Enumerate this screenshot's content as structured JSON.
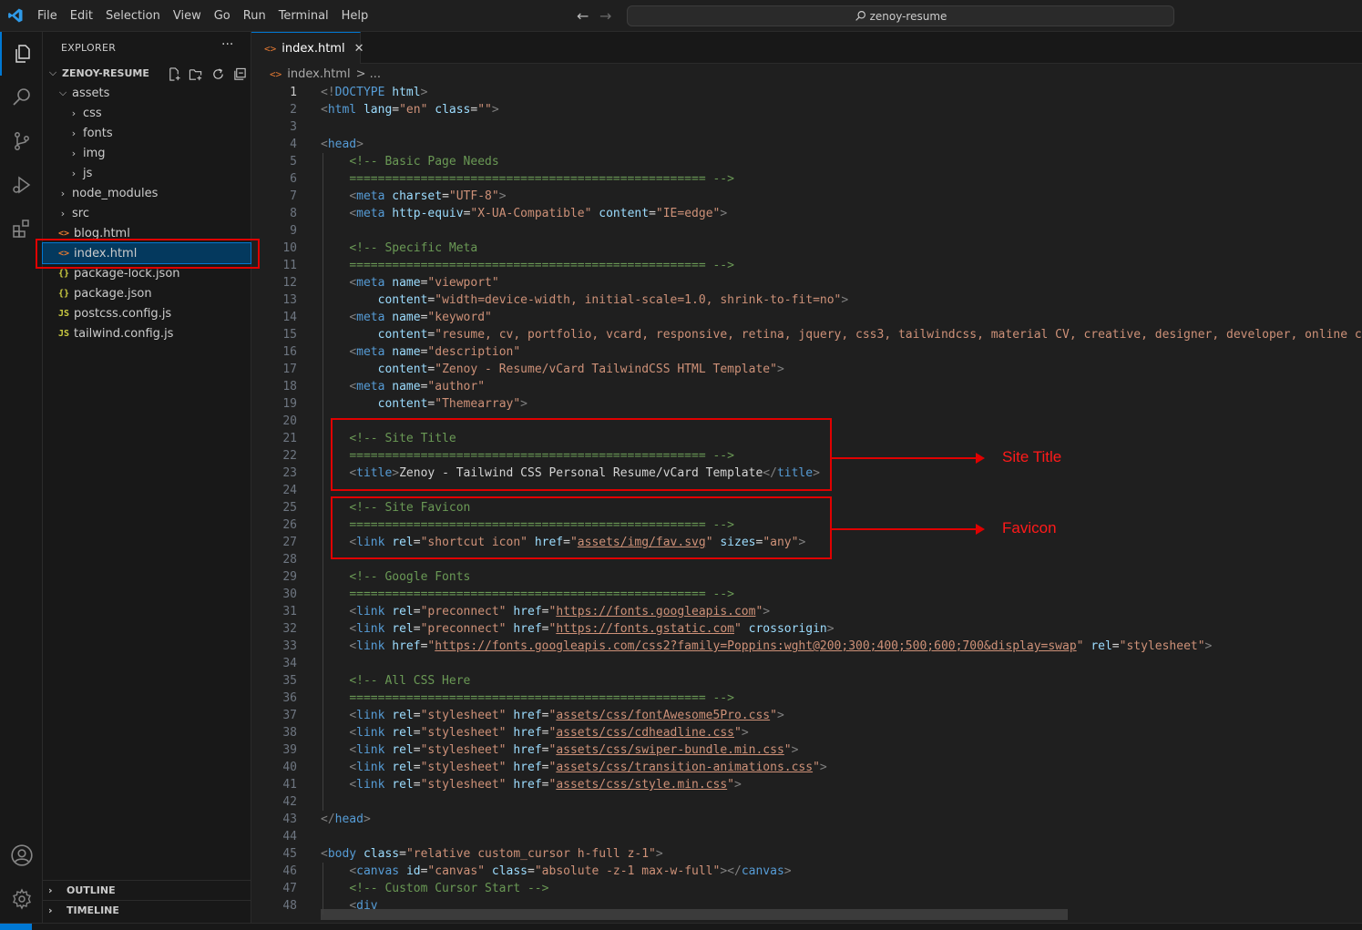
{
  "menu": [
    "File",
    "Edit",
    "Selection",
    "View",
    "Go",
    "Run",
    "Terminal",
    "Help"
  ],
  "search": {
    "text": "zenoy-resume"
  },
  "sidebar": {
    "title": "EXPLORER",
    "more": "···",
    "root": "ZENOY-RESUME",
    "tree": [
      {
        "label": "assets",
        "type": "folder-open",
        "depth": 1
      },
      {
        "label": "css",
        "type": "folder",
        "depth": 2
      },
      {
        "label": "fonts",
        "type": "folder",
        "depth": 2
      },
      {
        "label": "img",
        "type": "folder",
        "depth": 2
      },
      {
        "label": "js",
        "type": "folder",
        "depth": 2
      },
      {
        "label": "node_modules",
        "type": "folder",
        "depth": 1
      },
      {
        "label": "src",
        "type": "folder",
        "depth": 1
      },
      {
        "label": "blog.html",
        "type": "html",
        "depth": 1
      },
      {
        "label": "index.html",
        "type": "html",
        "depth": 1,
        "selected": true
      },
      {
        "label": "package-lock.json",
        "type": "json",
        "depth": 1
      },
      {
        "label": "package.json",
        "type": "json",
        "depth": 1
      },
      {
        "label": "postcss.config.js",
        "type": "js",
        "depth": 1
      },
      {
        "label": "tailwind.config.js",
        "type": "js",
        "depth": 1
      }
    ],
    "outline": "OUTLINE",
    "timeline": "TIMELINE"
  },
  "tab": {
    "label": "index.html",
    "close": "✕"
  },
  "breadcrumb": {
    "file": "index.html",
    "rest": "> ..."
  },
  "annotations": {
    "site_title": "Site Title",
    "favicon": "Favicon"
  },
  "code": [
    [
      [
        "t",
        "<!"
      ],
      [
        "n",
        "DOCTYPE"
      ],
      [
        "x",
        " "
      ],
      [
        "a",
        "html"
      ],
      [
        "t",
        ">"
      ]
    ],
    [
      [
        "t",
        "<"
      ],
      [
        "n",
        "html"
      ],
      [
        "x",
        " "
      ],
      [
        "a",
        "lang"
      ],
      [
        "x",
        "="
      ],
      [
        "s",
        "\"en\""
      ],
      [
        "x",
        " "
      ],
      [
        "a",
        "class"
      ],
      [
        "x",
        "="
      ],
      [
        "s",
        "\"\""
      ],
      [
        "t",
        ">"
      ]
    ],
    [],
    [
      [
        "t",
        "<"
      ],
      [
        "n",
        "head"
      ],
      [
        "t",
        ">"
      ]
    ],
    [
      [
        "x",
        "    "
      ],
      [
        "c",
        "<!-- Basic Page Needs"
      ]
    ],
    [
      [
        "x",
        "    "
      ],
      [
        "c",
        "================================================== -->"
      ]
    ],
    [
      [
        "x",
        "    "
      ],
      [
        "t",
        "<"
      ],
      [
        "n",
        "meta"
      ],
      [
        "x",
        " "
      ],
      [
        "a",
        "charset"
      ],
      [
        "x",
        "="
      ],
      [
        "s",
        "\"UTF-8\""
      ],
      [
        "t",
        ">"
      ]
    ],
    [
      [
        "x",
        "    "
      ],
      [
        "t",
        "<"
      ],
      [
        "n",
        "meta"
      ],
      [
        "x",
        " "
      ],
      [
        "a",
        "http-equiv"
      ],
      [
        "x",
        "="
      ],
      [
        "s",
        "\"X-UA-Compatible\""
      ],
      [
        "x",
        " "
      ],
      [
        "a",
        "content"
      ],
      [
        "x",
        "="
      ],
      [
        "s",
        "\"IE=edge\""
      ],
      [
        "t",
        ">"
      ]
    ],
    [],
    [
      [
        "x",
        "    "
      ],
      [
        "c",
        "<!-- Specific Meta"
      ]
    ],
    [
      [
        "x",
        "    "
      ],
      [
        "c",
        "================================================== -->"
      ]
    ],
    [
      [
        "x",
        "    "
      ],
      [
        "t",
        "<"
      ],
      [
        "n",
        "meta"
      ],
      [
        "x",
        " "
      ],
      [
        "a",
        "name"
      ],
      [
        "x",
        "="
      ],
      [
        "s",
        "\"viewport\""
      ]
    ],
    [
      [
        "x",
        "        "
      ],
      [
        "a",
        "content"
      ],
      [
        "x",
        "="
      ],
      [
        "s",
        "\"width=device-width, initial-scale=1.0, shrink-to-fit=no\""
      ],
      [
        "t",
        ">"
      ]
    ],
    [
      [
        "x",
        "    "
      ],
      [
        "t",
        "<"
      ],
      [
        "n",
        "meta"
      ],
      [
        "x",
        " "
      ],
      [
        "a",
        "name"
      ],
      [
        "x",
        "="
      ],
      [
        "s",
        "\"keyword\""
      ]
    ],
    [
      [
        "x",
        "        "
      ],
      [
        "a",
        "content"
      ],
      [
        "x",
        "="
      ],
      [
        "s",
        "\"resume, cv, portfolio, vcard, responsive, retina, jquery, css3, tailwindcss, material CV, creative, designer, developer, online cv,"
      ]
    ],
    [
      [
        "x",
        "    "
      ],
      [
        "t",
        "<"
      ],
      [
        "n",
        "meta"
      ],
      [
        "x",
        " "
      ],
      [
        "a",
        "name"
      ],
      [
        "x",
        "="
      ],
      [
        "s",
        "\"description\""
      ]
    ],
    [
      [
        "x",
        "        "
      ],
      [
        "a",
        "content"
      ],
      [
        "x",
        "="
      ],
      [
        "s",
        "\"Zenoy - Resume/vCard TailwindCSS HTML Template\""
      ],
      [
        "t",
        ">"
      ]
    ],
    [
      [
        "x",
        "    "
      ],
      [
        "t",
        "<"
      ],
      [
        "n",
        "meta"
      ],
      [
        "x",
        " "
      ],
      [
        "a",
        "name"
      ],
      [
        "x",
        "="
      ],
      [
        "s",
        "\"author\""
      ]
    ],
    [
      [
        "x",
        "        "
      ],
      [
        "a",
        "content"
      ],
      [
        "x",
        "="
      ],
      [
        "s",
        "\"Themearray\""
      ],
      [
        "t",
        ">"
      ]
    ],
    [],
    [
      [
        "x",
        "    "
      ],
      [
        "c",
        "<!-- Site Title"
      ]
    ],
    [
      [
        "x",
        "    "
      ],
      [
        "c",
        "================================================== -->"
      ]
    ],
    [
      [
        "x",
        "    "
      ],
      [
        "t",
        "<"
      ],
      [
        "n",
        "title"
      ],
      [
        "t",
        ">"
      ],
      [
        "x",
        "Zenoy - Tailwind CSS Personal Resume/vCard Template"
      ],
      [
        "t",
        "</"
      ],
      [
        "n",
        "title"
      ],
      [
        "t",
        ">"
      ]
    ],
    [],
    [
      [
        "x",
        "    "
      ],
      [
        "c",
        "<!-- Site Favicon"
      ]
    ],
    [
      [
        "x",
        "    "
      ],
      [
        "c",
        "================================================== -->"
      ]
    ],
    [
      [
        "x",
        "    "
      ],
      [
        "t",
        "<"
      ],
      [
        "n",
        "link"
      ],
      [
        "x",
        " "
      ],
      [
        "a",
        "rel"
      ],
      [
        "x",
        "="
      ],
      [
        "s",
        "\"shortcut icon\""
      ],
      [
        "x",
        " "
      ],
      [
        "a",
        "href"
      ],
      [
        "x",
        "="
      ],
      [
        "s",
        "\""
      ],
      [
        "l",
        "assets/img/fav.svg"
      ],
      [
        "s",
        "\""
      ],
      [
        "x",
        " "
      ],
      [
        "a",
        "sizes"
      ],
      [
        "x",
        "="
      ],
      [
        "s",
        "\"any\""
      ],
      [
        "t",
        ">"
      ]
    ],
    [],
    [
      [
        "x",
        "    "
      ],
      [
        "c",
        "<!-- Google Fonts"
      ]
    ],
    [
      [
        "x",
        "    "
      ],
      [
        "c",
        "================================================== -->"
      ]
    ],
    [
      [
        "x",
        "    "
      ],
      [
        "t",
        "<"
      ],
      [
        "n",
        "link"
      ],
      [
        "x",
        " "
      ],
      [
        "a",
        "rel"
      ],
      [
        "x",
        "="
      ],
      [
        "s",
        "\"preconnect\""
      ],
      [
        "x",
        " "
      ],
      [
        "a",
        "href"
      ],
      [
        "x",
        "="
      ],
      [
        "s",
        "\""
      ],
      [
        "l",
        "https://fonts.googleapis.com"
      ],
      [
        "s",
        "\""
      ],
      [
        "t",
        ">"
      ]
    ],
    [
      [
        "x",
        "    "
      ],
      [
        "t",
        "<"
      ],
      [
        "n",
        "link"
      ],
      [
        "x",
        " "
      ],
      [
        "a",
        "rel"
      ],
      [
        "x",
        "="
      ],
      [
        "s",
        "\"preconnect\""
      ],
      [
        "x",
        " "
      ],
      [
        "a",
        "href"
      ],
      [
        "x",
        "="
      ],
      [
        "s",
        "\""
      ],
      [
        "l",
        "https://fonts.gstatic.com"
      ],
      [
        "s",
        "\""
      ],
      [
        "x",
        " "
      ],
      [
        "a",
        "crossorigin"
      ],
      [
        "t",
        ">"
      ]
    ],
    [
      [
        "x",
        "    "
      ],
      [
        "t",
        "<"
      ],
      [
        "n",
        "link"
      ],
      [
        "x",
        " "
      ],
      [
        "a",
        "href"
      ],
      [
        "x",
        "="
      ],
      [
        "s",
        "\""
      ],
      [
        "l",
        "https://fonts.googleapis.com/css2?family=Poppins:wght@200;300;400;500;600;700&display=swap"
      ],
      [
        "s",
        "\""
      ],
      [
        "x",
        " "
      ],
      [
        "a",
        "rel"
      ],
      [
        "x",
        "="
      ],
      [
        "s",
        "\"stylesheet\""
      ],
      [
        "t",
        ">"
      ]
    ],
    [],
    [
      [
        "x",
        "    "
      ],
      [
        "c",
        "<!-- All CSS Here"
      ]
    ],
    [
      [
        "x",
        "    "
      ],
      [
        "c",
        "================================================== -->"
      ]
    ],
    [
      [
        "x",
        "    "
      ],
      [
        "t",
        "<"
      ],
      [
        "n",
        "link"
      ],
      [
        "x",
        " "
      ],
      [
        "a",
        "rel"
      ],
      [
        "x",
        "="
      ],
      [
        "s",
        "\"stylesheet\""
      ],
      [
        "x",
        " "
      ],
      [
        "a",
        "href"
      ],
      [
        "x",
        "="
      ],
      [
        "s",
        "\""
      ],
      [
        "l",
        "assets/css/fontAwesome5Pro.css"
      ],
      [
        "s",
        "\""
      ],
      [
        "t",
        ">"
      ]
    ],
    [
      [
        "x",
        "    "
      ],
      [
        "t",
        "<"
      ],
      [
        "n",
        "link"
      ],
      [
        "x",
        " "
      ],
      [
        "a",
        "rel"
      ],
      [
        "x",
        "="
      ],
      [
        "s",
        "\"stylesheet\""
      ],
      [
        "x",
        " "
      ],
      [
        "a",
        "href"
      ],
      [
        "x",
        "="
      ],
      [
        "s",
        "\""
      ],
      [
        "l",
        "assets/css/cdheadline.css"
      ],
      [
        "s",
        "\""
      ],
      [
        "t",
        ">"
      ]
    ],
    [
      [
        "x",
        "    "
      ],
      [
        "t",
        "<"
      ],
      [
        "n",
        "link"
      ],
      [
        "x",
        " "
      ],
      [
        "a",
        "rel"
      ],
      [
        "x",
        "="
      ],
      [
        "s",
        "\"stylesheet\""
      ],
      [
        "x",
        " "
      ],
      [
        "a",
        "href"
      ],
      [
        "x",
        "="
      ],
      [
        "s",
        "\""
      ],
      [
        "l",
        "assets/css/swiper-bundle.min.css"
      ],
      [
        "s",
        "\""
      ],
      [
        "t",
        ">"
      ]
    ],
    [
      [
        "x",
        "    "
      ],
      [
        "t",
        "<"
      ],
      [
        "n",
        "link"
      ],
      [
        "x",
        " "
      ],
      [
        "a",
        "rel"
      ],
      [
        "x",
        "="
      ],
      [
        "s",
        "\"stylesheet\""
      ],
      [
        "x",
        " "
      ],
      [
        "a",
        "href"
      ],
      [
        "x",
        "="
      ],
      [
        "s",
        "\""
      ],
      [
        "l",
        "assets/css/transition-animations.css"
      ],
      [
        "s",
        "\""
      ],
      [
        "t",
        ">"
      ]
    ],
    [
      [
        "x",
        "    "
      ],
      [
        "t",
        "<"
      ],
      [
        "n",
        "link"
      ],
      [
        "x",
        " "
      ],
      [
        "a",
        "rel"
      ],
      [
        "x",
        "="
      ],
      [
        "s",
        "\"stylesheet\""
      ],
      [
        "x",
        " "
      ],
      [
        "a",
        "href"
      ],
      [
        "x",
        "="
      ],
      [
        "s",
        "\""
      ],
      [
        "l",
        "assets/css/style.min.css"
      ],
      [
        "s",
        "\""
      ],
      [
        "t",
        ">"
      ]
    ],
    [],
    [
      [
        "t",
        "</"
      ],
      [
        "n",
        "head"
      ],
      [
        "t",
        ">"
      ]
    ],
    [],
    [
      [
        "t",
        "<"
      ],
      [
        "n",
        "body"
      ],
      [
        "x",
        " "
      ],
      [
        "a",
        "class"
      ],
      [
        "x",
        "="
      ],
      [
        "s",
        "\"relative custom_cursor h-full z-1\""
      ],
      [
        "t",
        ">"
      ]
    ],
    [
      [
        "x",
        "    "
      ],
      [
        "t",
        "<"
      ],
      [
        "n",
        "canvas"
      ],
      [
        "x",
        " "
      ],
      [
        "a",
        "id"
      ],
      [
        "x",
        "="
      ],
      [
        "s",
        "\"canvas\""
      ],
      [
        "x",
        " "
      ],
      [
        "a",
        "class"
      ],
      [
        "x",
        "="
      ],
      [
        "s",
        "\"absolute -z-1 max-w-full\""
      ],
      [
        "t",
        "></"
      ],
      [
        "n",
        "canvas"
      ],
      [
        "t",
        ">"
      ]
    ],
    [
      [
        "x",
        "    "
      ],
      [
        "c",
        "<!-- Custom Cursor Start -->"
      ]
    ],
    [
      [
        "x",
        "    "
      ],
      [
        "t",
        "<"
      ],
      [
        "n",
        "div"
      ]
    ]
  ],
  "current_line": 1
}
